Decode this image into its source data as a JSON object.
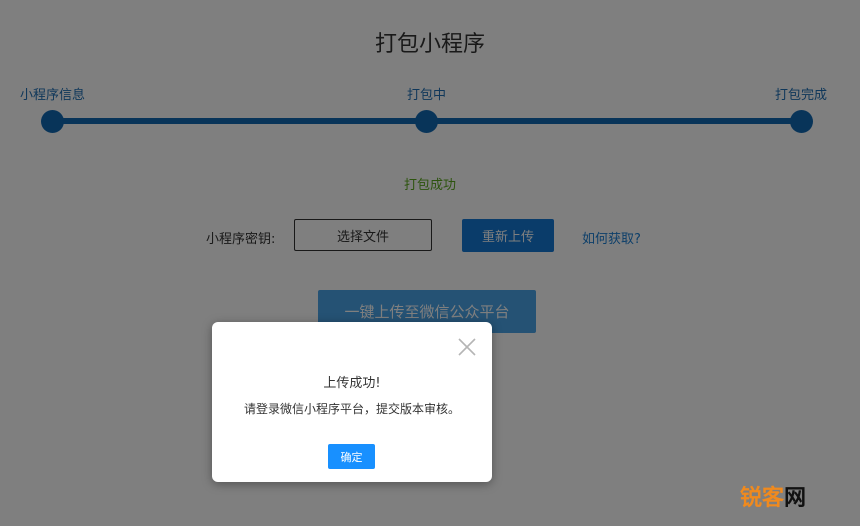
{
  "page": {
    "title": "打包小程序",
    "steps": [
      "小程序信息",
      "打包中",
      "打包完成"
    ],
    "status": "打包成功",
    "key_label": "小程序密钥:",
    "file_button": "选择文件",
    "reupload_button": "重新上传",
    "howto_link": "如何获取?",
    "publish_button": "一键上传至微信公众平台"
  },
  "modal": {
    "title": "上传成功!",
    "message": "请登录微信小程序平台，提交版本审核。",
    "ok_button": "确定"
  },
  "watermark": {
    "part1": "锐",
    "part2": "客",
    "part3": "网"
  },
  "colors": {
    "accent": "#1168b3",
    "button": "#1479d5",
    "success": "#5aa81c",
    "modal_ok": "#1890ff"
  }
}
